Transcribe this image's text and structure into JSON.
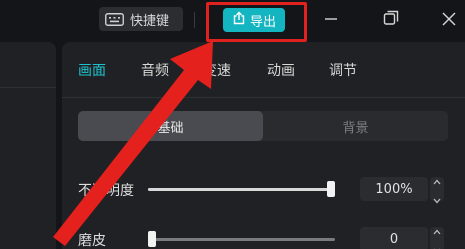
{
  "titlebar": {
    "shortcut_label": "快捷键",
    "export_label": "导出",
    "accent_color": "#13b5c1",
    "highlight_color": "#e0221e"
  },
  "panel": {
    "tabs": [
      {
        "label": "画面",
        "active": true
      },
      {
        "label": "音频",
        "active": false
      },
      {
        "label": "变速",
        "active": false
      },
      {
        "label": "动画",
        "active": false
      },
      {
        "label": "调节",
        "active": false
      }
    ],
    "segments": [
      {
        "label": "基础",
        "active": true
      },
      {
        "label": "背景",
        "active": false
      }
    ],
    "opacity": {
      "label": "不透明度",
      "value": "100%",
      "level": 1.0
    },
    "smoothing": {
      "label": "磨皮",
      "value": "0",
      "level": 0.0
    }
  },
  "icons": [
    "keyboard-icon",
    "export-icon",
    "minimize-icon",
    "restore-icon",
    "close-icon",
    "caret-up-icon",
    "caret-down-icon"
  ]
}
